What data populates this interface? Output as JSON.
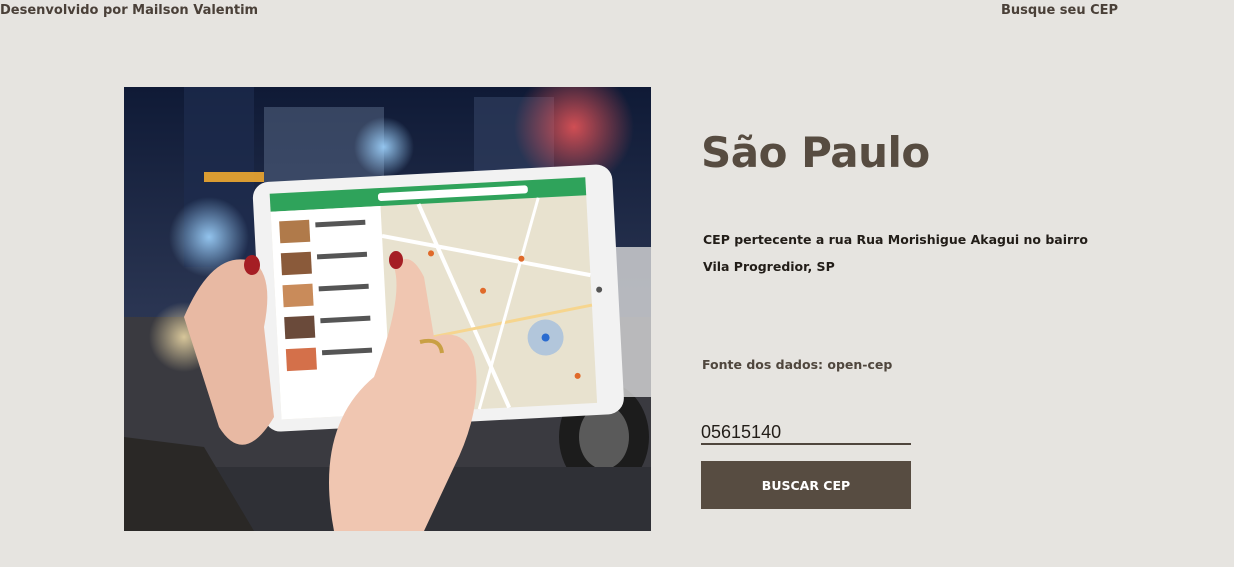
{
  "header": {
    "credit": "Desenvolvido por Mailson Valentim",
    "nav_link": "Busque seu CEP"
  },
  "result": {
    "city": "São Paulo",
    "description": "CEP pertecente a rua Rua Morishigue Akagui no bairro Vila Progredior, SP",
    "source": "Fonte dos dados: open-cep"
  },
  "search": {
    "value": "05615140",
    "button_label": "BUSCAR CEP"
  },
  "colors": {
    "background": "#e6e4e0",
    "primary": "#574c41",
    "text_dark": "#221d18",
    "button_text": "#ffffff"
  },
  "icons": {
    "hero": "tablet-map-photo"
  }
}
